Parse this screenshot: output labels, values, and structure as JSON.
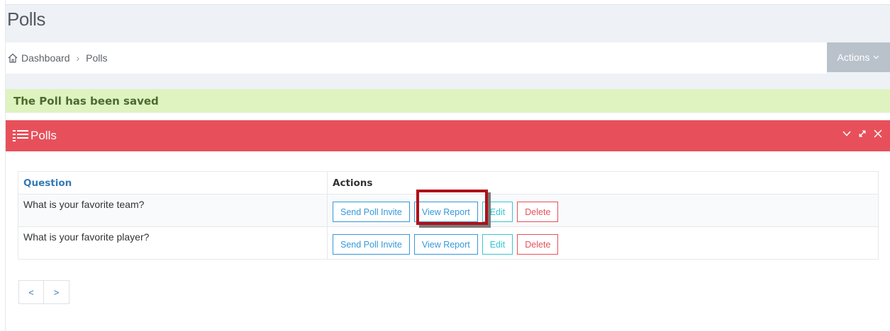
{
  "page": {
    "title": "Polls"
  },
  "breadcrumb": {
    "home_label": "Dashboard",
    "current_label": "Polls"
  },
  "toolbar": {
    "actions_label": "Actions"
  },
  "alert": {
    "message": "The Poll has been saved",
    "color": "#dff3c0"
  },
  "panel": {
    "title": "Polls",
    "accent": "#e7505a"
  },
  "table": {
    "headers": {
      "question": "Question",
      "actions": "Actions"
    },
    "rows": [
      {
        "question": "What is your favorite team?",
        "send": "Send Poll Invite",
        "report": "View Report",
        "edit": "Edit",
        "delete": "Delete"
      },
      {
        "question": "What is your favorite player?",
        "send": "Send Poll Invite",
        "report": "View Report",
        "edit": "Edit",
        "delete": "Delete"
      }
    ]
  },
  "pager": {
    "prev": "<",
    "next": ">"
  },
  "icons": {
    "home": "home-icon",
    "list": "list-icon",
    "collapse": "chevron-down-icon",
    "expand": "expand-icon",
    "close": "close-icon",
    "actions_chevron": "chevron-down-icon"
  }
}
